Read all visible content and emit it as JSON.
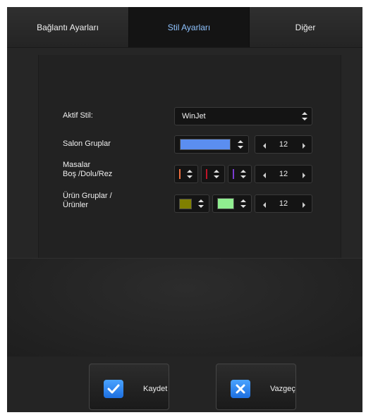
{
  "tabs": [
    {
      "label": "Bağlantı Ayarları"
    },
    {
      "label": "Stil Ayarları"
    },
    {
      "label": "Diğer"
    }
  ],
  "form": {
    "active_style_label": "Aktif Stil:",
    "active_style_value": "WinJet",
    "salon_label": "Salon Gruplar",
    "salon_color": "#5b8ef0",
    "salon_size": "12",
    "tables_label_line1": "Masalar",
    "tables_label_line2": "Boş /Dolu/Rez",
    "tables_colors": [
      "#f07040",
      "#c01428",
      "#7a3cd0"
    ],
    "tables_size": "12",
    "products_label_line1": "Ürün Gruplar /",
    "products_label_line2": "Ürünler",
    "products_color_group": "#808000",
    "products_color_item": "#90ee90",
    "products_size": "12"
  },
  "buttons": {
    "save": "Kaydet",
    "cancel": "Vazgeç"
  },
  "colors": {
    "active_tab_text": "#8fc3ff",
    "button_icon_bg": "#2a86f2"
  }
}
